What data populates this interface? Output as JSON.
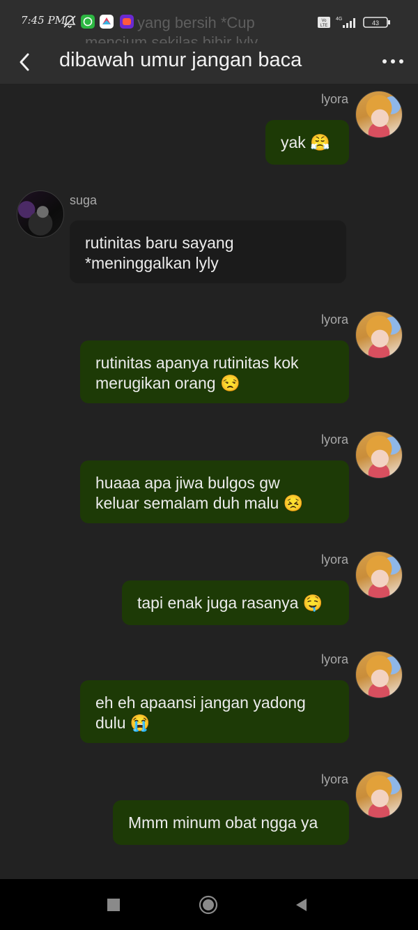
{
  "status_bar": {
    "time": "7:45 PM",
    "ghost_line1": "yang bersih *Cup",
    "ghost_line2": "mencium sekilas bibir lyly",
    "volte": "Vo LTE",
    "network": "4G",
    "battery": "43",
    "icons": [
      "mute-bell-icon",
      "whatsapp-icon",
      "app-icon",
      "lazada-icon",
      "volte-icon",
      "signal-icon",
      "battery-icon"
    ]
  },
  "header": {
    "title": "dibawah umur jangan baca"
  },
  "messages": [
    {
      "sender": "lyora",
      "text": "yak 😤",
      "side": "me"
    },
    {
      "sender": "suga",
      "text": "rutinitas baru sayang\n*meninggalkan lyly",
      "side": "them"
    },
    {
      "sender": "lyora",
      "text": "rutinitas apanya rutinitas kok\nmerugikan orang 😒",
      "side": "me"
    },
    {
      "sender": "lyora",
      "text": "huaaa apa jiwa bulgos gw\nkeluar semalam duh malu 😣",
      "side": "me"
    },
    {
      "sender": "lyora",
      "text": "tapi enak juga rasanya 🤤",
      "side": "me"
    },
    {
      "sender": "lyora",
      "text": "eh eh apaansi jangan yadong\ndulu 😭",
      "side": "me"
    },
    {
      "sender": "lyora",
      "text": "Mmm minum obat ngga ya",
      "side": "me"
    }
  ],
  "colors": {
    "background": "#222222",
    "header": "#2e2e2e",
    "my_bubble": "#1d3a06",
    "their_bubble": "#1b1b1b",
    "nav_bar": "#000000"
  },
  "nav": {
    "icons": [
      "recent-apps-icon",
      "home-icon",
      "back-nav-icon"
    ]
  }
}
